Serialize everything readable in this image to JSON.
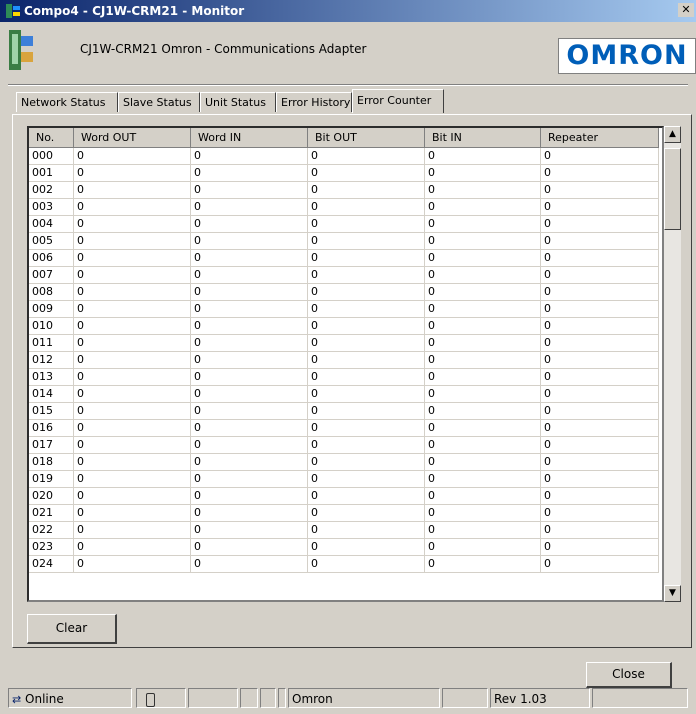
{
  "window": {
    "title": "Compo4 - CJ1W-CRM21 - Monitor"
  },
  "header": {
    "device": "CJ1W-CRM21   Omron - Communications Adapter",
    "logo": "OMRON"
  },
  "tabs": [
    {
      "label": "Network Status",
      "active": false
    },
    {
      "label": "Slave Status",
      "active": false
    },
    {
      "label": "Unit Status",
      "active": false
    },
    {
      "label": "Error History",
      "active": false
    },
    {
      "label": "Error Counter",
      "active": true
    }
  ],
  "table": {
    "columns": [
      "No.",
      "Word OUT",
      "Word IN",
      "Bit OUT",
      "Bit IN",
      "Repeater"
    ],
    "rows": [
      [
        "000",
        "0",
        "0",
        "0",
        "0",
        "0"
      ],
      [
        "001",
        "0",
        "0",
        "0",
        "0",
        "0"
      ],
      [
        "002",
        "0",
        "0",
        "0",
        "0",
        "0"
      ],
      [
        "003",
        "0",
        "0",
        "0",
        "0",
        "0"
      ],
      [
        "004",
        "0",
        "0",
        "0",
        "0",
        "0"
      ],
      [
        "005",
        "0",
        "0",
        "0",
        "0",
        "0"
      ],
      [
        "006",
        "0",
        "0",
        "0",
        "0",
        "0"
      ],
      [
        "007",
        "0",
        "0",
        "0",
        "0",
        "0"
      ],
      [
        "008",
        "0",
        "0",
        "0",
        "0",
        "0"
      ],
      [
        "009",
        "0",
        "0",
        "0",
        "0",
        "0"
      ],
      [
        "010",
        "0",
        "0",
        "0",
        "0",
        "0"
      ],
      [
        "011",
        "0",
        "0",
        "0",
        "0",
        "0"
      ],
      [
        "012",
        "0",
        "0",
        "0",
        "0",
        "0"
      ],
      [
        "013",
        "0",
        "0",
        "0",
        "0",
        "0"
      ],
      [
        "014",
        "0",
        "0",
        "0",
        "0",
        "0"
      ],
      [
        "015",
        "0",
        "0",
        "0",
        "0",
        "0"
      ],
      [
        "016",
        "0",
        "0",
        "0",
        "0",
        "0"
      ],
      [
        "017",
        "0",
        "0",
        "0",
        "0",
        "0"
      ],
      [
        "018",
        "0",
        "0",
        "0",
        "0",
        "0"
      ],
      [
        "019",
        "0",
        "0",
        "0",
        "0",
        "0"
      ],
      [
        "020",
        "0",
        "0",
        "0",
        "0",
        "0"
      ],
      [
        "021",
        "0",
        "0",
        "0",
        "0",
        "0"
      ],
      [
        "022",
        "0",
        "0",
        "0",
        "0",
        "0"
      ],
      [
        "023",
        "0",
        "0",
        "0",
        "0",
        "0"
      ],
      [
        "024",
        "0",
        "0",
        "0",
        "0",
        "0"
      ]
    ]
  },
  "buttons": {
    "clear": "Clear",
    "close": "Close"
  },
  "status": {
    "online": "Online",
    "vendor": "Omron",
    "revision": "Rev 1.03"
  },
  "colors": {
    "title_gradient_start": "#0a246a",
    "title_gradient_end": "#a6caf0",
    "logo_blue": "#005eb8",
    "face": "#d4d0c8"
  }
}
